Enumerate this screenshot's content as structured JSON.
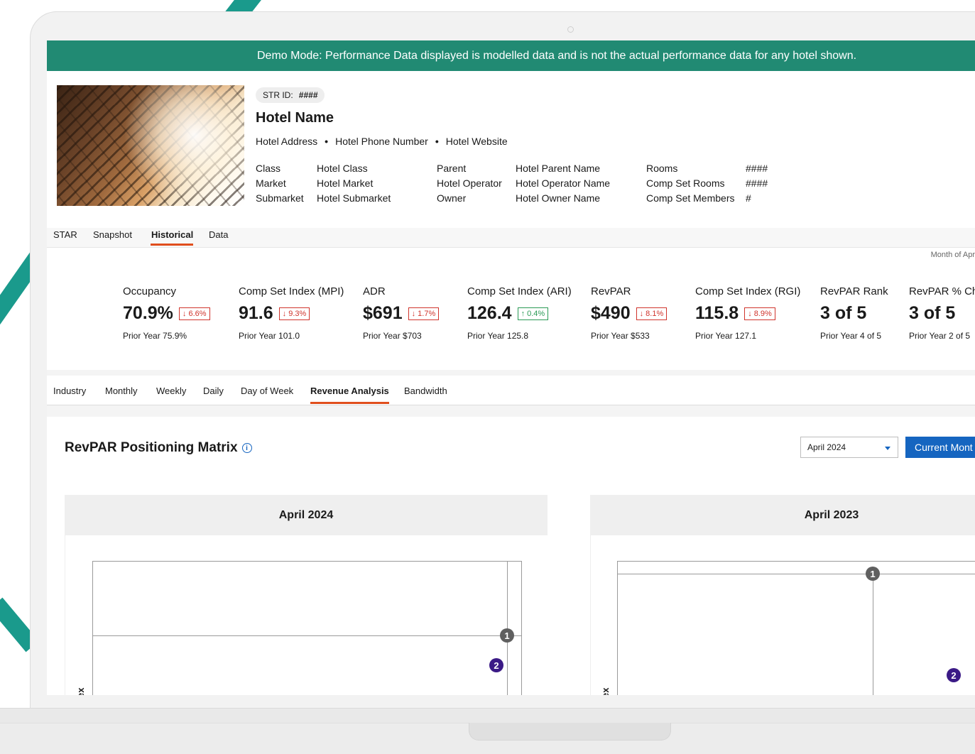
{
  "banner": {
    "text": "Demo Mode: Performance Data displayed is modelled data and is not the actual performance data for any hotel shown."
  },
  "hotel": {
    "str_id_label": "STR ID:",
    "str_id_value": "####",
    "name": "Hotel Name",
    "address": "Hotel Address",
    "phone": "Hotel Phone Number",
    "website": "Hotel Website",
    "separator": "•"
  },
  "info": {
    "col1_labels": [
      "Class",
      "Market",
      "Submarket"
    ],
    "col1_values": [
      "Hotel Class",
      "Hotel Market",
      "Hotel Submarket"
    ],
    "col2_labels": [
      "Parent",
      "Hotel Operator",
      "Owner"
    ],
    "col2_values": [
      "Hotel Parent Name",
      "Hotel Operator Name",
      "Hotel Owner Name"
    ],
    "col3_labels": [
      "Rooms",
      "Comp Set Rooms",
      "Comp Set Members"
    ],
    "col3_values": [
      "####",
      "####",
      "#"
    ]
  },
  "main_tabs": [
    "STAR",
    "Snapshot",
    "Historical",
    "Data"
  ],
  "active_main_tab": "Historical",
  "period_label": "Month of Apr",
  "kpis": [
    {
      "label": "Occupancy",
      "value": "70.9%",
      "delta": "↓ 6.6%",
      "direction": "down",
      "prior": "Prior Year  75.9%"
    },
    {
      "label": "Comp Set Index (MPI)",
      "value": "91.6",
      "delta": "↓ 9.3%",
      "direction": "down",
      "prior": "Prior Year  101.0"
    },
    {
      "label": "ADR",
      "value": "$691",
      "delta": "↓ 1.7%",
      "direction": "down",
      "prior": "Prior Year  $703"
    },
    {
      "label": "Comp Set Index (ARI)",
      "value": "126.4",
      "delta": "↑ 0.4%",
      "direction": "up",
      "prior": "Prior Year  125.8"
    },
    {
      "label": "RevPAR",
      "value": "$490",
      "delta": "↓ 8.1%",
      "direction": "down",
      "prior": "Prior Year  $533"
    },
    {
      "label": "Comp Set Index (RGI)",
      "value": "115.8",
      "delta": "↓ 8.9%",
      "direction": "down",
      "prior": "Prior Year  127.1"
    },
    {
      "label": "RevPAR Rank",
      "value": "3 of 5",
      "delta": "",
      "direction": "",
      "prior": "Prior Year  4 of 5"
    },
    {
      "label": "RevPAR % Ch",
      "value": "3 of 5",
      "delta": "",
      "direction": "",
      "prior": "Prior Year  2 of 5"
    }
  ],
  "sub_tabs": [
    "Industry",
    "Monthly",
    "Weekly",
    "Daily",
    "Day of Week",
    "Revenue Analysis",
    "Bandwidth"
  ],
  "active_sub_tab": "Revenue Analysis",
  "matrix": {
    "title": "RevPAR Positioning Matrix",
    "info_icon": "info-icon",
    "select_value": "April 2024",
    "current_button": "Current Mont",
    "panels": [
      {
        "title": "April 2024",
        "axis_label": "ex",
        "markers": [
          "1",
          "2"
        ]
      },
      {
        "title": "April 2023",
        "axis_label": "ex",
        "markers": [
          "1",
          "2"
        ]
      }
    ]
  },
  "colors": {
    "banner": "#218a73",
    "accent_tab": "#e04e1d",
    "primary_button": "#1565c0",
    "delta_down": "#d0342c",
    "delta_up": "#2a9a55",
    "marker_hotel": "#3b1a86",
    "marker_compset": "#5f5f5f"
  }
}
